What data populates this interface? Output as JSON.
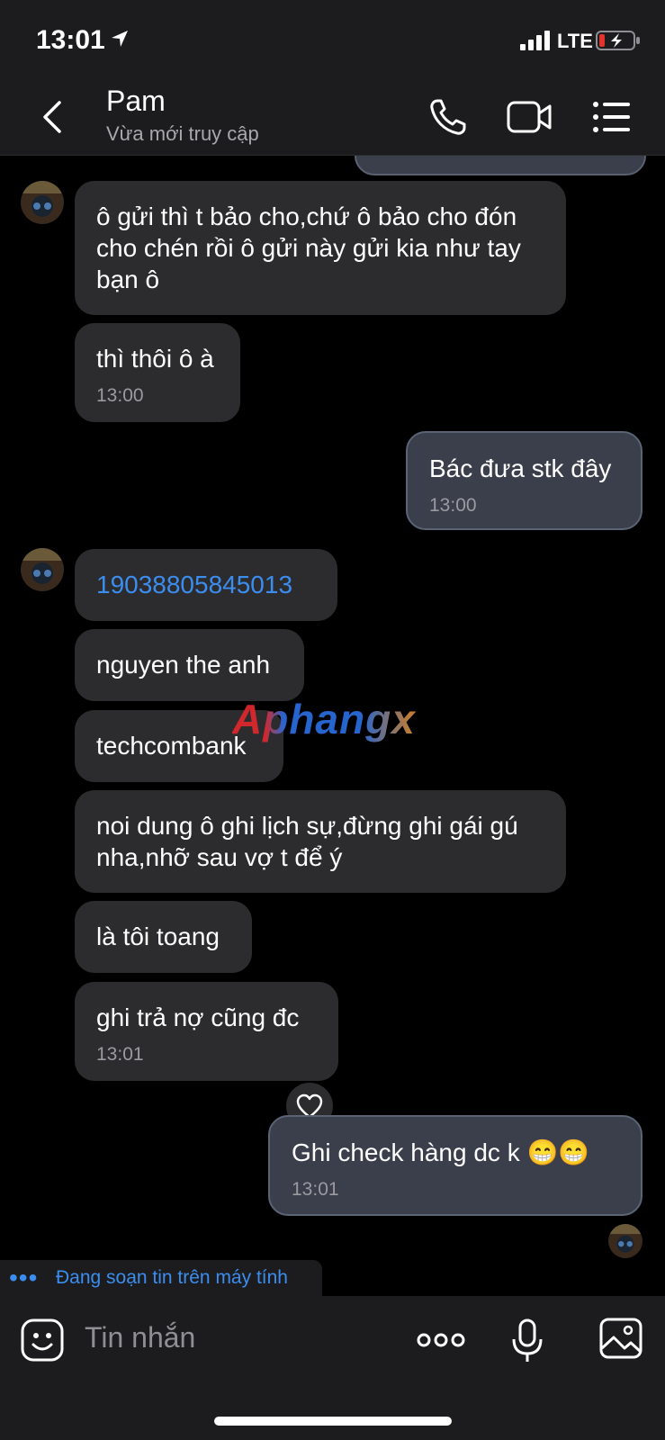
{
  "status": {
    "time": "13:01",
    "network": "LTE"
  },
  "header": {
    "name": "Pam",
    "status": "Vừa mới truy cập"
  },
  "messages": [
    {
      "dir": "in",
      "text": "ô gửi thì t bảo cho,chứ ô bảo cho đón cho chén rồi ô gửi này gửi kia như tay bạn ô",
      "time": ""
    },
    {
      "dir": "in",
      "text": "thì thôi ô à",
      "time": "13:00"
    },
    {
      "dir": "out",
      "text": "Bác đưa stk đây",
      "time": "13:00"
    },
    {
      "dir": "in",
      "text": "19038805845013",
      "time": ""
    },
    {
      "dir": "in",
      "text": "nguyen the anh",
      "time": ""
    },
    {
      "dir": "in",
      "text": "techcombank",
      "time": ""
    },
    {
      "dir": "in",
      "text": "noi dung ô ghi lịch sự,đừng ghi gái gú nha,nhỡ sau vợ t để ý",
      "time": ""
    },
    {
      "dir": "in",
      "text": "là tôi toang",
      "time": ""
    },
    {
      "dir": "in",
      "text": "ghi trả nợ cũng đc",
      "time": "13:01"
    },
    {
      "dir": "out",
      "text": "Ghi check hàng dc k 😁😁",
      "time": "13:01"
    }
  ],
  "typing": "Đang soạn tin trên máy tính",
  "input": {
    "placeholder": "Tin nhắn"
  },
  "watermark": "Aphangx",
  "colors": {
    "link": "#3b8ef0",
    "incoming_bubble": "#2c2c2e",
    "outgoing_bubble": "#3a3f4b",
    "background": "#000000"
  }
}
